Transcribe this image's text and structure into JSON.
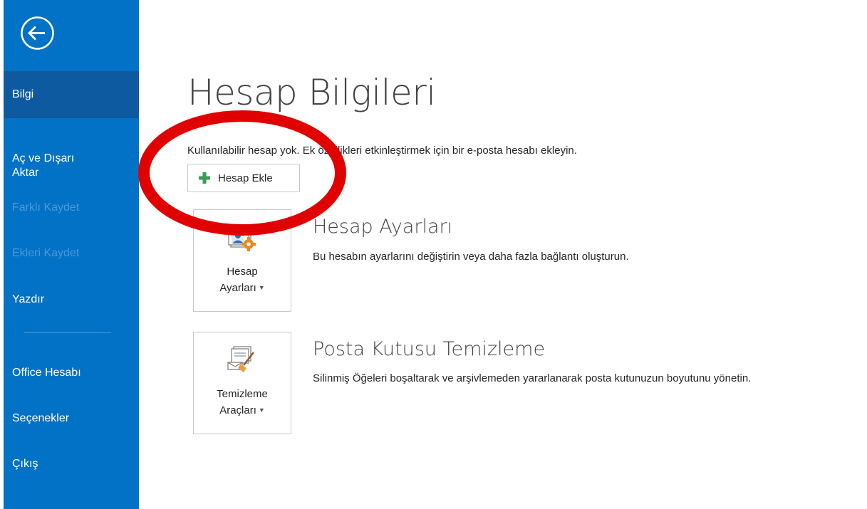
{
  "sidebar": {
    "back_label": "",
    "items": [
      {
        "label": "Bilgi",
        "state": "active"
      },
      {
        "label": "Aç ve Dışarı\nAktar",
        "state": "normal"
      },
      {
        "label": "Farklı Kaydet",
        "state": "disabled"
      },
      {
        "label": "Ekleri Kaydet",
        "state": "disabled"
      },
      {
        "label": "Yazdır",
        "state": "normal"
      },
      {
        "label": "Office Hesabı",
        "state": "normal"
      },
      {
        "label": "Seçenekler",
        "state": "normal"
      },
      {
        "label": "Çıkış",
        "state": "normal"
      }
    ]
  },
  "main": {
    "title": "Hesap Bilgileri",
    "info_text": "Kullanılabilir hesap yok. Ek özellikleri etkinleştirmek için bir e-posta hesabı ekleyin.",
    "add_account_label": "Hesap Ekle",
    "sections": [
      {
        "tile_line1": "Hesap",
        "tile_line2": "Ayarları",
        "title": "Hesap Ayarları",
        "description": "Bu hesabın ayarlarını değiştirin veya daha fazla bağlantı oluşturun."
      },
      {
        "tile_line1": "Temizleme",
        "tile_line2": "Araçları",
        "title": "Posta Kutusu Temizleme",
        "description": "Silinmiş Öğeleri boşaltarak ve arşivlemeden yararlanarak posta kutunuzun boyutunu yönetin."
      }
    ]
  },
  "colors": {
    "sidebar_bg": "#0172c6",
    "sidebar_active": "#0e5aa0",
    "annotation_red": "#e00000"
  },
  "icons": {
    "back": "back-arrow-icon",
    "add": "plus-icon",
    "account_settings": "account-settings-icon",
    "cleanup_tools": "cleanup-tools-icon"
  }
}
